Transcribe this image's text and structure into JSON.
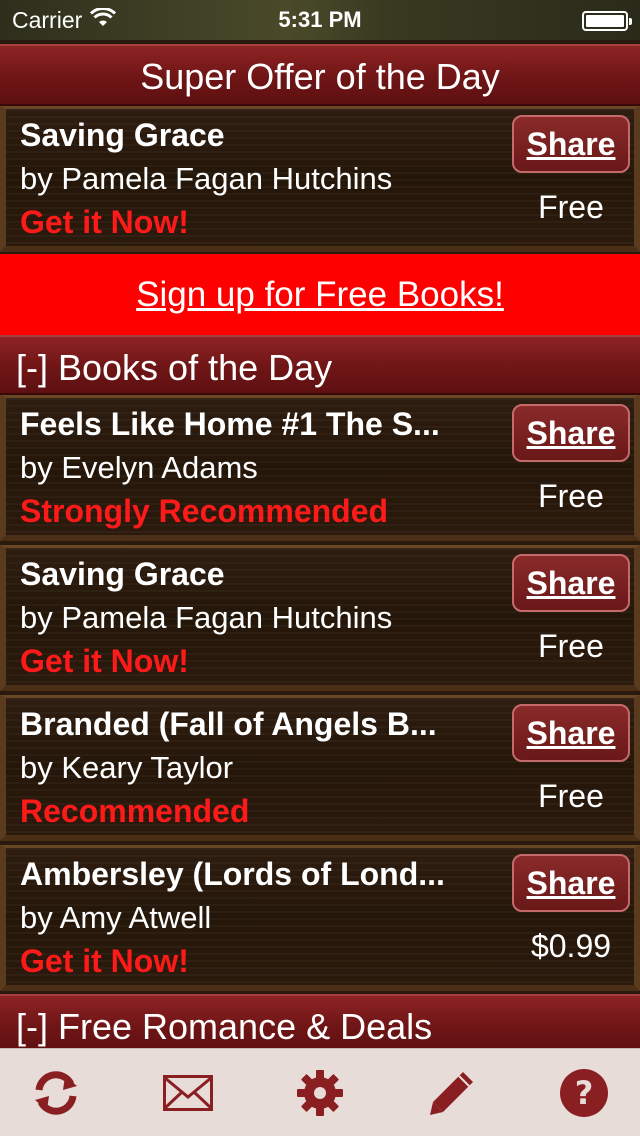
{
  "status_bar": {
    "carrier": "Carrier",
    "time": "5:31 PM"
  },
  "offer": {
    "header": "Super Offer of the Day",
    "book": {
      "title": "Saving Grace",
      "author": "by Pamela Fagan Hutchins",
      "tag": "Get it Now!",
      "share_label": "Share",
      "price": "Free"
    }
  },
  "signup": {
    "label": "Sign up for Free Books!"
  },
  "books_of_day": {
    "header": "[-]  Books of the Day",
    "items": [
      {
        "title": "Feels Like Home #1 The S...",
        "author": "by Evelyn Adams",
        "tag": "Strongly Recommended",
        "share_label": "Share",
        "price": "Free"
      },
      {
        "title": "Saving Grace",
        "author": "by Pamela Fagan Hutchins",
        "tag": "Get it Now!",
        "share_label": "Share",
        "price": "Free"
      },
      {
        "title": "Branded (Fall of Angels B...",
        "author": "by Keary Taylor",
        "tag": "Recommended",
        "share_label": "Share",
        "price": "Free"
      },
      {
        "title": "Ambersley (Lords of Lond...",
        "author": "by Amy Atwell",
        "tag": "Get it Now!",
        "share_label": "Share",
        "price": "$0.99"
      }
    ]
  },
  "romance": {
    "header": "[-]  Free Romance & Deals"
  },
  "toolbar": {
    "icons": [
      "refresh-icon",
      "mail-icon",
      "gear-icon",
      "pencil-icon",
      "help-icon"
    ]
  },
  "colors": {
    "accent_red": "#ff1a1a",
    "banner_red": "#ff0000",
    "header_maroon": "#7a1a1b",
    "icon_maroon": "#8a1f22",
    "toolbar_bg": "#e8dcd9"
  }
}
